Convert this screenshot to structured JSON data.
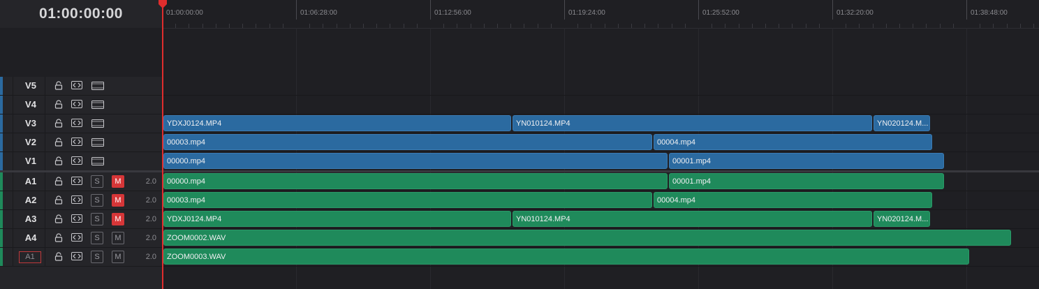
{
  "timecode": "01:00:00:00",
  "ruler": {
    "labels": [
      "01:00:00:00",
      "01:06:28:00",
      "01:12:56:00",
      "01:19:24:00",
      "01:25:52:00",
      "01:32:20:00",
      "01:38:48:00"
    ]
  },
  "video_tracks": [
    {
      "name": "V5"
    },
    {
      "name": "V4"
    },
    {
      "name": "V3"
    },
    {
      "name": "V2"
    },
    {
      "name": "V1"
    }
  ],
  "audio_tracks": [
    {
      "name": "A1",
      "solo": "S",
      "mute": "M",
      "mute_on": true,
      "volume": "2.0"
    },
    {
      "name": "A2",
      "solo": "S",
      "mute": "M",
      "mute_on": true,
      "volume": "2.0"
    },
    {
      "name": "A3",
      "solo": "S",
      "mute": "M",
      "mute_on": true,
      "volume": "2.0"
    },
    {
      "name": "A4",
      "solo": "S",
      "mute": "M",
      "mute_on": false,
      "volume": "2.0"
    },
    {
      "name": "A1",
      "patch": true,
      "solo": "S",
      "mute": "M",
      "mute_on": false,
      "volume": "2.0"
    }
  ],
  "clips": {
    "V3": [
      {
        "label": "YDXJ0124.MP4"
      },
      {
        "label": "YN010124.MP4"
      },
      {
        "label": "YN020124.M..."
      }
    ],
    "V2": [
      {
        "label": "00003.mp4"
      },
      {
        "label": "00004.mp4"
      }
    ],
    "V1": [
      {
        "label": "00000.mp4"
      },
      {
        "label": "00001.mp4"
      }
    ],
    "A1": [
      {
        "label": "00000.mp4"
      },
      {
        "label": "00001.mp4"
      }
    ],
    "A2": [
      {
        "label": "00003.mp4"
      },
      {
        "label": "00004.mp4"
      }
    ],
    "A3": [
      {
        "label": "YDXJ0124.MP4"
      },
      {
        "label": "YN010124.MP4"
      },
      {
        "label": "YN020124.M..."
      }
    ],
    "A4": [
      {
        "label": "ZOOM0002.WAV"
      }
    ],
    "A5": [
      {
        "label": "ZOOM0003.WAV"
      }
    ]
  },
  "colors": {
    "video_clip": "#2b6aa0",
    "audio_clip": "#1f8a5b",
    "playhead": "#e02d2d",
    "mute_on": "#d63638",
    "video_track_bar": "#2b6aa0",
    "audio_track_bar": "#1f8a5b"
  },
  "icons": [
    "lock-icon",
    "link-icon",
    "video-monitor-icon",
    "playhead-marker-icon"
  ]
}
